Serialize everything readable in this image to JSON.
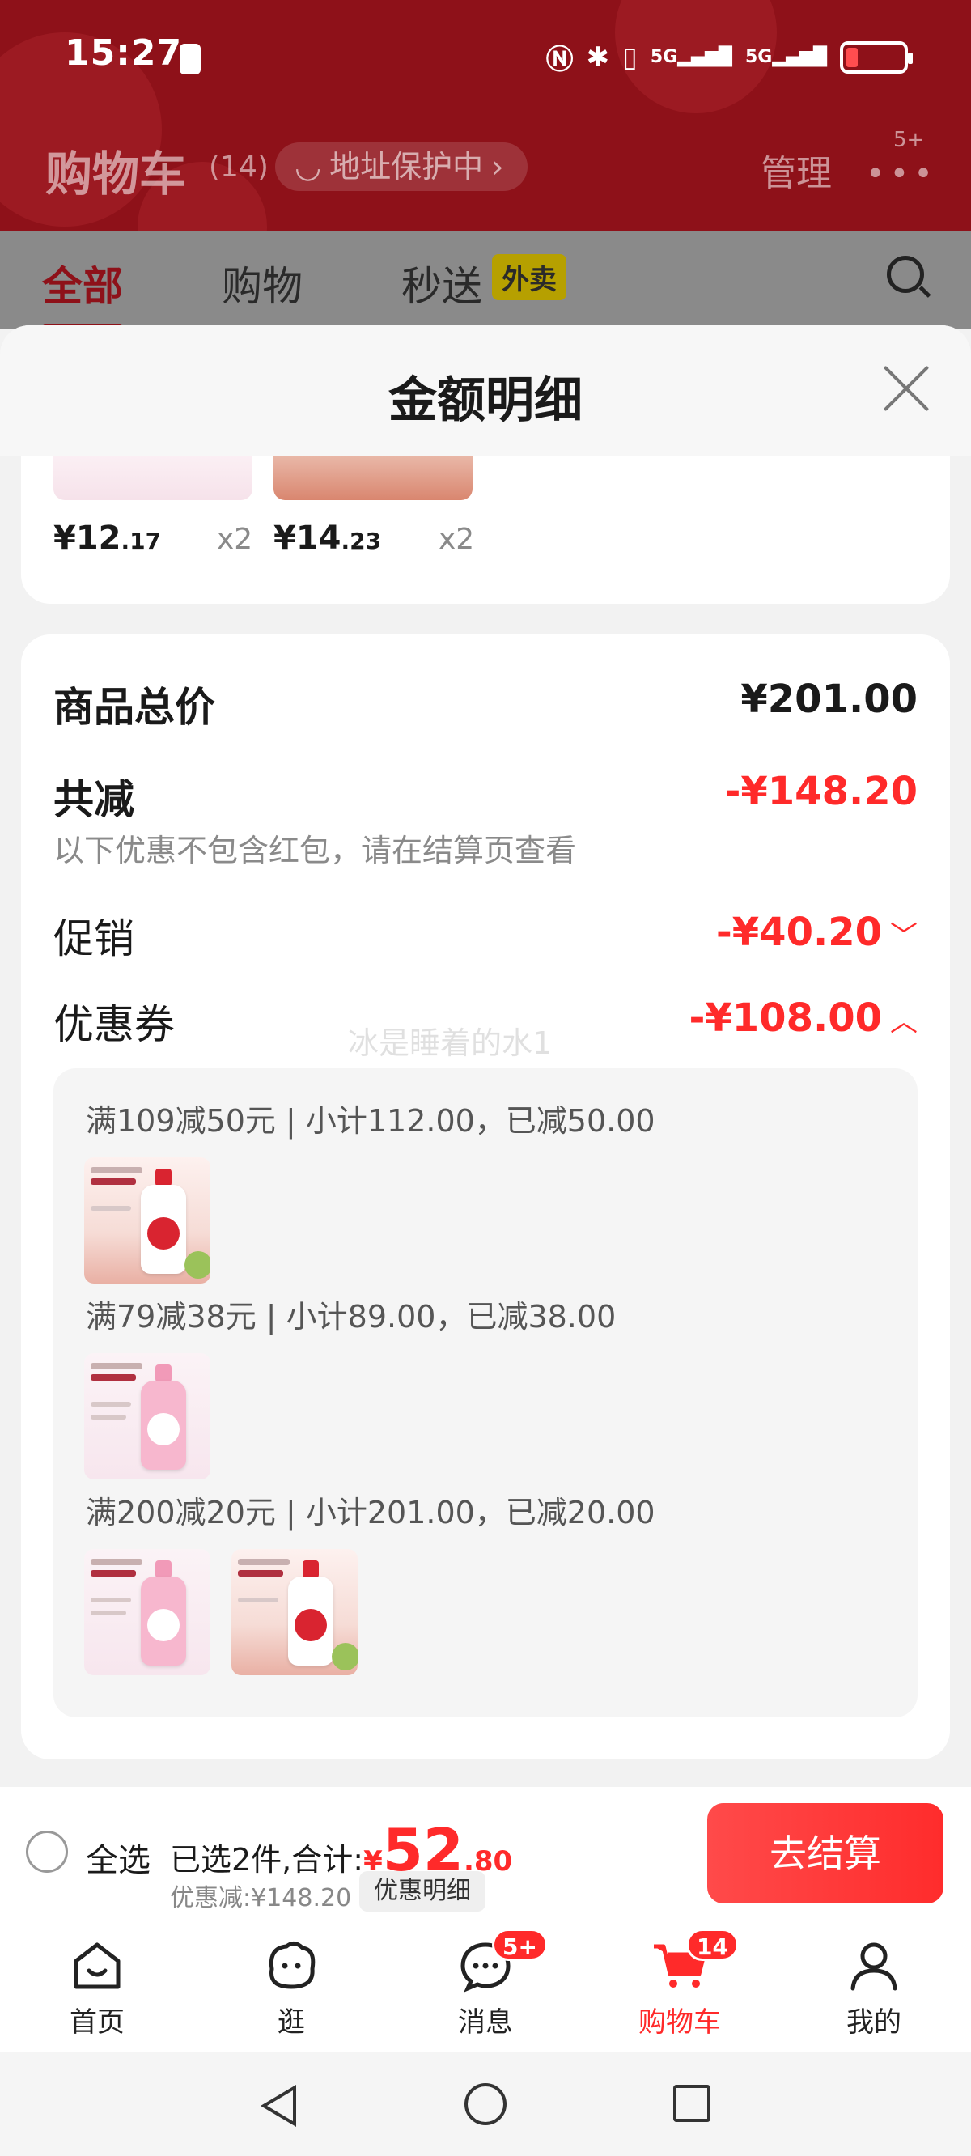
{
  "status_bar": {
    "time": "15:27",
    "network1": "5G",
    "network2": "5G"
  },
  "header": {
    "title": "购物车",
    "count": "(14)",
    "address_pill": "地址保护中",
    "manage": "管理",
    "more_badge": "5+"
  },
  "tabs": [
    {
      "label": "全部",
      "active": true
    },
    {
      "label": "购物",
      "active": false
    },
    {
      "label": "秒送",
      "active": false
    }
  ],
  "tab_tag": "外卖",
  "sheet": {
    "title": "金额明细",
    "items": [
      {
        "price_int": "¥12",
        "price_dec": ".17",
        "qty": "x2"
      },
      {
        "price_int": "¥14",
        "price_dec": ".23",
        "qty": "x2"
      }
    ],
    "total_label": "商品总价",
    "total_value": "¥201.00",
    "reduce_label": "共减",
    "reduce_value": "-¥148.20",
    "reduce_note": "以下优惠不包含红包，请在结算页查看",
    "promo_label": "促销",
    "promo_value": "-¥40.20",
    "coupon_label": "优惠券",
    "coupon_value": "-¥108.00",
    "watermark": "冰是睡着的水1",
    "coupons": [
      {
        "line": "满109减50元 | 小计112.00，已减50.00"
      },
      {
        "line": "满79减38元 | 小计89.00，已减38.00"
      },
      {
        "line": "满200减20元 | 小计201.00，已减20.00"
      }
    ]
  },
  "checkout": {
    "select_all": "全选",
    "selected_text": "已选2件,合计:",
    "yen": "¥",
    "sum_int": "52",
    "sum_dec": ".80",
    "discount_text": "优惠减:¥148.20",
    "detail_button": "优惠明细",
    "checkout_button": "去结算"
  },
  "tabbar": [
    {
      "label": "首页",
      "icon": "home-icon"
    },
    {
      "label": "逛",
      "icon": "browse-icon"
    },
    {
      "label": "消息",
      "icon": "message-icon",
      "badge": "5+"
    },
    {
      "label": "购物车",
      "icon": "cart-icon",
      "badge": "14",
      "active": true
    },
    {
      "label": "我的",
      "icon": "profile-icon"
    }
  ],
  "colors": {
    "accent": "#ff2a2a",
    "header_red": "#8e1119"
  }
}
